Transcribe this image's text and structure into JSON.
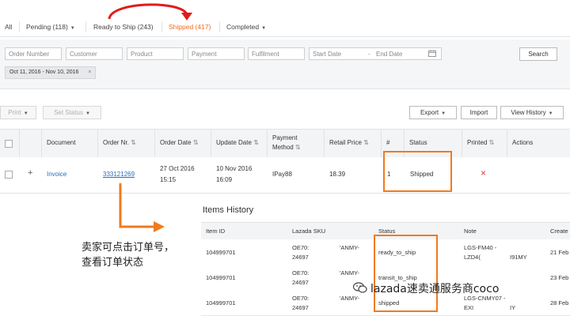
{
  "tabs": [
    {
      "label": "All"
    },
    {
      "label": "Pending (118)"
    },
    {
      "label": "Ready to Ship (243)"
    },
    {
      "label": "Shipped (417)"
    },
    {
      "label": "Completed"
    }
  ],
  "filters": {
    "order_number": "Order Number",
    "customer": "Customer",
    "product": "Product",
    "payment": "Payment",
    "fulfilment": "Fulfilment",
    "start_date": "Start Date",
    "date_sep": "-",
    "end_date": "End Date",
    "search_label": "Search",
    "date_chip": "Oct 11, 2016 - Nov 10, 2016",
    "chip_close": "×"
  },
  "actions": {
    "print": "Print",
    "set_status": "Set Status",
    "export": "Export",
    "import": "Import",
    "view_history": "View History"
  },
  "orders_table": {
    "headers": {
      "document": "Document",
      "order_nr": "Order Nr.",
      "order_date": "Order Date",
      "update_date": "Update Date",
      "payment_method_1": "Payment",
      "payment_method_2": "Method",
      "retail_price": "Retail Price",
      "count": "#",
      "status": "Status",
      "printed": "Printed",
      "actions": "Actions"
    },
    "rows": [
      {
        "expand": "+",
        "document": "Invoice",
        "order_nr": "333121269",
        "order_date_1": "27 Oct 2016",
        "order_date_2": "15:15",
        "update_date_1": "10 Nov 2016",
        "update_date_2": "16:09",
        "payment_method": "IPay88",
        "retail_price": "18.39",
        "count": "1",
        "status": "Shipped",
        "printed": "×"
      }
    ]
  },
  "items_history": {
    "title": "Items History",
    "headers": {
      "item_id": "Item ID",
      "sku": "Lazada SKU",
      "status": "Status",
      "note": "Note",
      "created": "Create"
    },
    "rows": [
      {
        "item_id": "104999701",
        "sku_1": "OE70:",
        "sku_1b": "'ANMY-",
        "sku_2": "24697",
        "status": "ready_to_ship",
        "note_1": "LGS-FM40 -",
        "note_2": "LZD4(",
        "note_2b": "I91MY",
        "created": "21 Feb"
      },
      {
        "item_id": "104999701",
        "sku_1": "OE70:",
        "sku_1b": "'ANMY-",
        "sku_2": "24697",
        "status": "transit_to_ship",
        "note_1": "",
        "note_2": "",
        "note_2b": "",
        "created": "23 Feb"
      },
      {
        "item_id": "104999701",
        "sku_1": "OE70:",
        "sku_1b": "'ANMY-",
        "sku_2": "24697",
        "status": "shipped",
        "note_1": "LGS-CNMY07 -",
        "note_2": "EXI",
        "note_2b": "IY",
        "created": "28 Feb"
      }
    ]
  },
  "annotation": {
    "line1": "卖家可点击订单号，",
    "line2": "查看订单状态"
  },
  "watermark": "lazada速卖通服务商coco",
  "colors": {
    "accent_orange": "#f26b21",
    "highlight_box": "#f07a1e",
    "arrow_red": "#e11b1b",
    "link_blue": "#2a6ebb",
    "printed_red": "#e23b3b"
  }
}
